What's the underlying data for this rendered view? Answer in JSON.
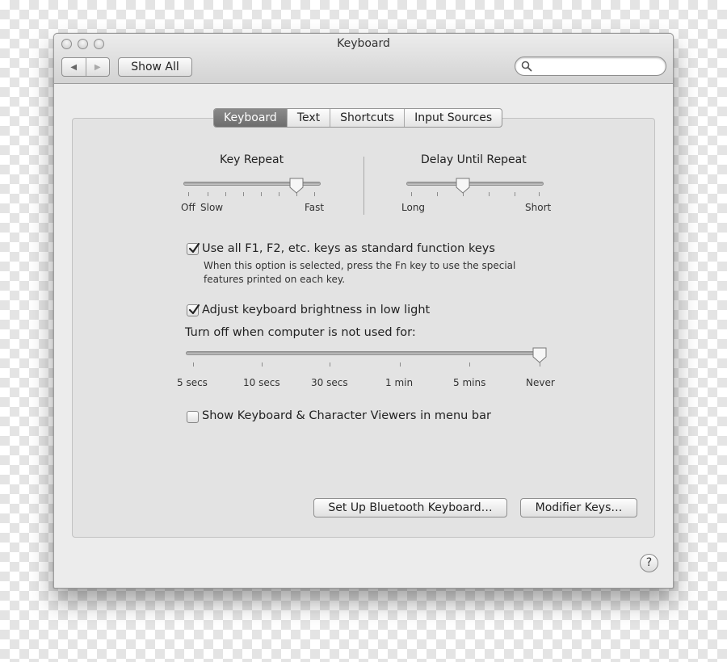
{
  "window": {
    "title": "Keyboard"
  },
  "toolbar": {
    "back_icon": "◀",
    "forward_icon": "▶",
    "show_all_label": "Show All",
    "search": {
      "value": "",
      "placeholder": ""
    }
  },
  "tabs": [
    {
      "label": "Keyboard",
      "selected": true
    },
    {
      "label": "Text",
      "selected": false
    },
    {
      "label": "Shortcuts",
      "selected": false
    },
    {
      "label": "Input Sources",
      "selected": false
    }
  ],
  "key_repeat": {
    "label": "Key Repeat",
    "tick_labels": {
      "off": "Off",
      "slow": "Slow",
      "fast": "Fast"
    },
    "value_fraction": 0.82
  },
  "delay_until_repeat": {
    "label": "Delay Until Repeat",
    "tick_labels": {
      "long": "Long",
      "short": "Short"
    },
    "value_fraction": 0.4
  },
  "function_keys": {
    "checked": true,
    "label": "Use all F1, F2, etc. keys as standard function keys",
    "description_line1": "When this option is selected, press the Fn key to use the special",
    "description_line2": "features printed on each key."
  },
  "brightness": {
    "checked": true,
    "label": "Adjust keyboard brightness in low light",
    "turn_off_label": "Turn off when computer is not used for:",
    "ticks": [
      "5 secs",
      "10 secs",
      "30 secs",
      "1 min",
      "5 mins",
      "Never"
    ],
    "selected_index": 5
  },
  "viewers": {
    "checked": false,
    "label": "Show Keyboard & Character Viewers in menu bar"
  },
  "buttons": {
    "bluetooth": "Set Up Bluetooth Keyboard…",
    "modifier": "Modifier Keys…",
    "help": "?"
  },
  "colors": {
    "window_bg": "#ececec",
    "selected_tab": "#7b7b7b"
  }
}
